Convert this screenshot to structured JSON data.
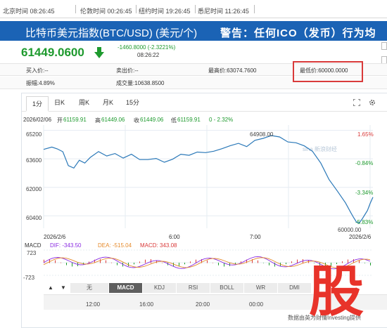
{
  "world_clocks": [
    {
      "label": "北京时间 08:26:45"
    },
    {
      "label": "伦敦时间 00:26:45"
    },
    {
      "label": "纽约时间 19:26:45"
    },
    {
      "label": "悉尼时间 11:26:45"
    }
  ],
  "header": {
    "title": "比特币美元指数(BTC/USD) (美元/个)",
    "warning": "警告：任何ICO（发币）行为均"
  },
  "quote": {
    "price": "61449.0600",
    "change": "-1460.8000 (-2.3221%)",
    "time": "08:26:22",
    "direction": "down"
  },
  "stats": {
    "bid": "买入价:--",
    "ask": "卖出价:--",
    "high": "最高价:63074.7600",
    "low": "最低价:60000.0000",
    "amplitude": "振幅:4.89%",
    "volume": "成交量:10638.8500"
  },
  "tabs": [
    {
      "label": "1分",
      "active": true
    },
    {
      "label": "日K",
      "active": false
    },
    {
      "label": "周K",
      "active": false
    },
    {
      "label": "月K",
      "active": false
    },
    {
      "label": "15分",
      "active": false
    }
  ],
  "ohlc_line": {
    "date": "2026/02/06",
    "open_label": "开",
    "open": "61159.91",
    "high_label": "高",
    "high": "61449.06",
    "close_label": "收",
    "close": "61449.06",
    "low_label": "低",
    "low": "61159.91",
    "change": "0 - 2.32%"
  },
  "chart_data": {
    "type": "line",
    "y_tick_labels": [
      "65200",
      "63600",
      "62000",
      "60400"
    ],
    "y_pct_labels": [
      "1.65%",
      "-0.84%",
      "-3.34%",
      "-5.83%"
    ],
    "x_tick_labels": [
      "2026/2/6",
      "6:00",
      "7:00",
      "2026/2/6"
    ],
    "annotations": [
      "64908.00",
      "60000.00"
    ],
    "ylim": [
      59700,
      65500
    ],
    "x": [
      0,
      3,
      5,
      7,
      9,
      11,
      13,
      15,
      17,
      20,
      23,
      26,
      29,
      32,
      35,
      38,
      41,
      44,
      47,
      50,
      53,
      56,
      59,
      62,
      65,
      68,
      71,
      74,
      77,
      80,
      83,
      86,
      89,
      92,
      95,
      98,
      101,
      104,
      107,
      110,
      112,
      113,
      114,
      115,
      116,
      117,
      118,
      119,
      120
    ],
    "values": [
      64130,
      64260,
      64160,
      64000,
      63220,
      63080,
      63520,
      63360,
      63680,
      64010,
      63760,
      63900,
      63640,
      63860,
      63560,
      63560,
      63620,
      63410,
      63580,
      63860,
      63800,
      63980,
      63950,
      64030,
      64170,
      64340,
      64470,
      64290,
      64640,
      64750,
      64910,
      64830,
      64550,
      64500,
      64330,
      64020,
      63360,
      62440,
      61800,
      61130,
      60560,
      60290,
      60050,
      60000,
      60200,
      60450,
      60700,
      61100,
      61449
    ],
    "pct_ref": 63980
  },
  "macd": {
    "label": "MACD",
    "dif": "DIF: -343.50",
    "dea": "DEA: -515.04",
    "macd_val": "MACD: 343.08",
    "upper": "723",
    "lower": "-723"
  },
  "indicators": [
    {
      "label": "无",
      "active": false
    },
    {
      "label": "MACD",
      "active": true
    },
    {
      "label": "KDJ",
      "active": false
    },
    {
      "label": "RSI",
      "active": false
    },
    {
      "label": "BOLL",
      "active": false
    },
    {
      "label": "WR",
      "active": false
    },
    {
      "label": "DMI",
      "active": false
    }
  ],
  "time_axis": [
    "12:00",
    "16:00",
    "20:00",
    "00:00"
  ],
  "watermark": "sina 新浪财经",
  "credit": "数据由英为财情Investing提供",
  "logo_char": "股",
  "colors": {
    "title_bar": "#1b63b5",
    "down": "#1e9a2e",
    "up": "#d93a3a",
    "line": "#2a78b8",
    "dif": "#8a2be2",
    "dea": "#e58a2b",
    "logo": "#e8332a"
  }
}
